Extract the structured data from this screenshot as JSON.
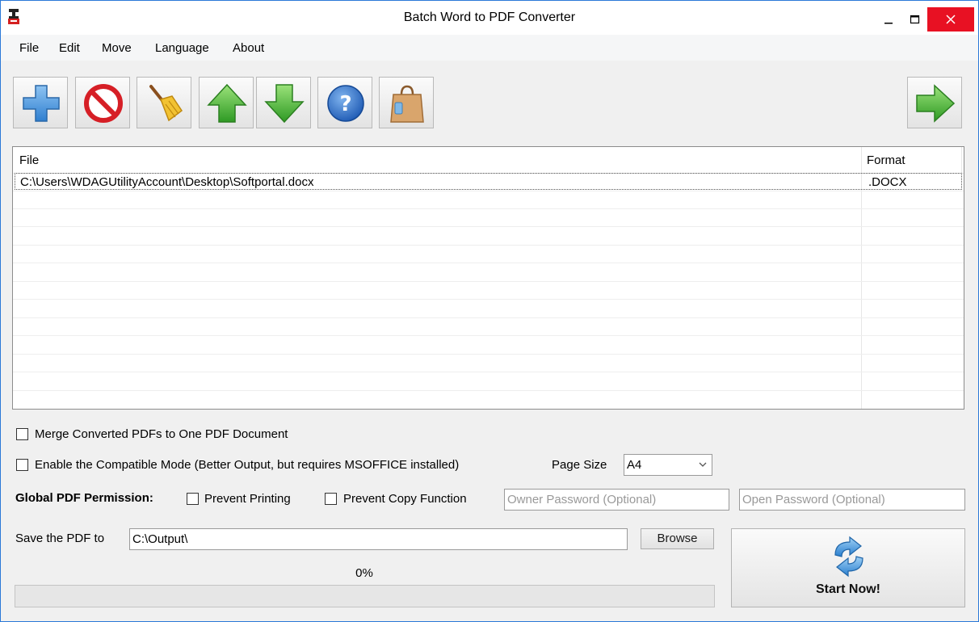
{
  "window": {
    "title": "Batch Word to PDF Converter",
    "close_color": "#e81123",
    "border_color": "#2b79d8"
  },
  "menu": {
    "items": [
      "File",
      "Edit",
      "Move",
      "Language",
      "About"
    ]
  },
  "toolbar": {
    "buttons": [
      "add-icon",
      "remove-icon",
      "clear-broom-icon",
      "move-up-icon",
      "move-down-icon",
      "help-icon",
      "buy-bag-icon"
    ],
    "convert_icon": "arrow-right-icon"
  },
  "file_list": {
    "columns": [
      "File",
      "Format"
    ],
    "rows": [
      {
        "file": "C:\\Users\\WDAGUtilityAccount\\Desktop\\Softportal.docx",
        "format": ".DOCX"
      }
    ]
  },
  "options": {
    "merge_label": "Merge Converted PDFs to One PDF Document",
    "merge_checked": false,
    "compat_label": "Enable the Compatible Mode (Better Output, but requires MSOFFICE installed)",
    "compat_checked": false,
    "page_size_label": "Page Size",
    "page_size_value": "A4"
  },
  "permission": {
    "label": "Global PDF Permission:",
    "prevent_printing_label": "Prevent Printing",
    "prevent_printing_checked": false,
    "prevent_copy_label": "Prevent Copy Function",
    "prevent_copy_checked": false,
    "owner_password_placeholder": "Owner Password (Optional)",
    "open_password_placeholder": "Open Password (Optional)"
  },
  "output": {
    "save_label": "Save the PDF to",
    "path": "C:\\Output\\",
    "browse_label": "Browse"
  },
  "progress": {
    "text": "0%",
    "fraction": 0
  },
  "start": {
    "label": "Start Now!",
    "icon": "refresh-icon"
  }
}
